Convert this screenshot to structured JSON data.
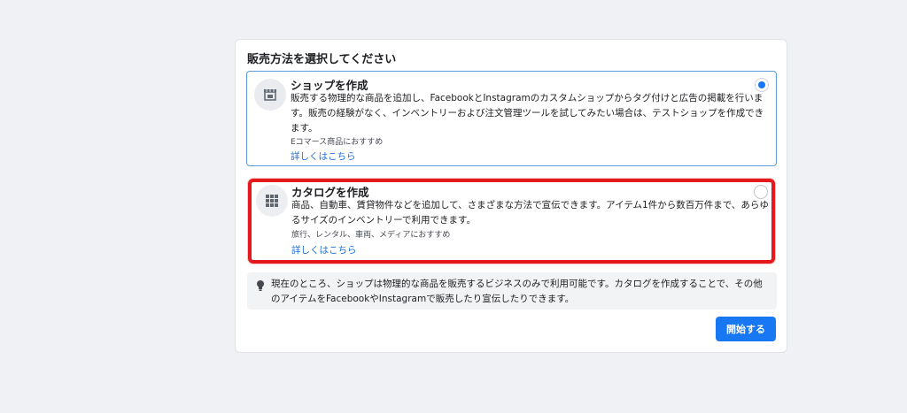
{
  "page": {
    "title": "販売方法を選択してください"
  },
  "options": [
    {
      "name": "ショップを作成",
      "icon": "storefront-icon",
      "description": "販売する物理的な商品を追加し、FacebookとInstagramのカスタムショップからタグ付けと広告の掲載を行います。販売の経験がなく、インベントリーおよび注文管理ツールを試してみたい場合は、テストショップを作成できます。",
      "note": "Eコマース商品におすすめ",
      "link": "詳しくはこちら",
      "selected": true
    },
    {
      "name": "カタログを作成",
      "icon": "grid-icon",
      "description": "商品、自動車、賃貸物件などを追加して、さまざまな方法で宣伝できます。アイテム1件から数百万件まで、あらゆるサイズのインベントリーで利用できます。",
      "note": "旅行、レンタル、車両、メディアにおすすめ",
      "link": "詳しくはこちら",
      "selected": false
    }
  ],
  "info": {
    "icon": "lightbulb-icon",
    "text": "現在のところ、ショップは物理的な商品を販売するビジネスのみで利用可能です。カタログを作成することで、その他のアイテムをFacebookやInstagramで販売したり宣伝したりできます。"
  },
  "actions": {
    "start_label": "開始する"
  },
  "colors": {
    "accent": "#1877f2",
    "highlight": "#e3191c",
    "link": "#216fdb",
    "background": "#f0f1f4"
  }
}
